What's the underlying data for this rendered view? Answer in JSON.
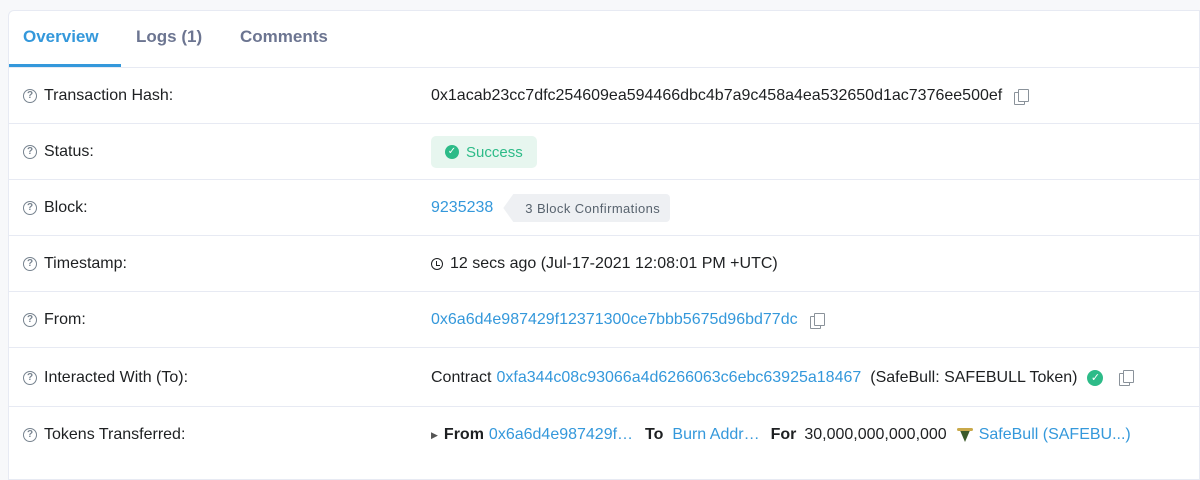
{
  "tabs": [
    {
      "label": "Overview",
      "active": true
    },
    {
      "label": "Logs (1)",
      "active": false
    },
    {
      "label": "Comments",
      "active": false
    }
  ],
  "help_glyph": "?",
  "rows": {
    "hash": {
      "label": "Transaction Hash:",
      "value": "0x1acab23cc7dfc254609ea594466dbc4b7a9c458a4ea532650d1ac7376ee500ef"
    },
    "status": {
      "label": "Status:",
      "value": "Success"
    },
    "block": {
      "label": "Block:",
      "value": "9235238",
      "confirmations": "3 Block Confirmations"
    },
    "timestamp": {
      "label": "Timestamp:",
      "value": "12 secs ago (Jul-17-2021 12:08:01 PM +UTC)"
    },
    "from": {
      "label": "From:",
      "value": "0x6a6d4e987429f12371300ce7bbb5675d96bd77dc"
    },
    "to": {
      "label": "Interacted With (To):",
      "prefix": "Contract",
      "address": "0xfa344c08c93066a4d6266063c6ebc63925a18467",
      "name": "(SafeBull: SAFEBULL Token)"
    },
    "tokens": {
      "label": "Tokens Transferred:",
      "from_label": "From",
      "from_value": "0x6a6d4e987429f…",
      "to_label": "To",
      "to_value": "Burn Addr…",
      "for_label": "For",
      "amount": "30,000,000,000,000",
      "token": "SafeBull (SAFEBU...)"
    }
  },
  "icons": {
    "help": "question-circle-icon",
    "copy": "copy-icon",
    "clock": "clock-icon",
    "check": "check-circle-icon"
  },
  "colors": {
    "accent": "#3498db",
    "success": "#2dbb88",
    "success_bg": "#e7f6ef",
    "border": "#e7eaf3"
  }
}
